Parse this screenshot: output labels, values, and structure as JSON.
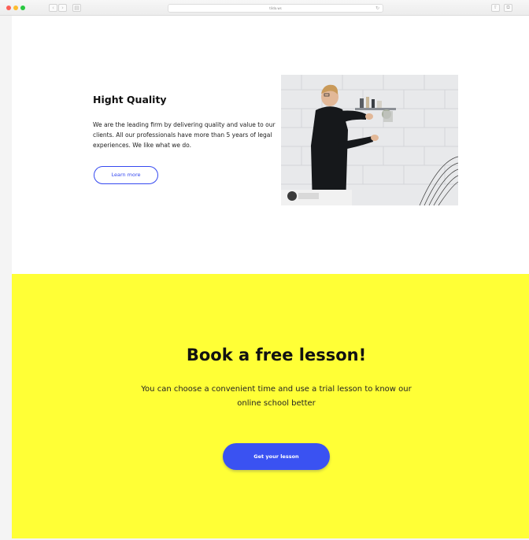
{
  "browser": {
    "address": "tilda.ws",
    "nav_back": "‹",
    "nav_forward": "›",
    "sidebar_toggle": "▤",
    "reload": "↻",
    "share": "⇧",
    "tabs_overview": "⧉"
  },
  "feature": {
    "title": "Hight Quality",
    "text": "We are the leading firm by delivering quality and value to our clients. All our professionals have more than 5 years of legal experiences. We like what we do.",
    "button_label": "Learn more"
  },
  "cta": {
    "title": "Book a free lesson!",
    "subtitle": "You can choose a convenient time and use a trial lesson to know our online school better",
    "button_label": "Get your lesson"
  },
  "colors": {
    "cta_background": "#ffff36",
    "accent_blue": "#3a52f2"
  }
}
